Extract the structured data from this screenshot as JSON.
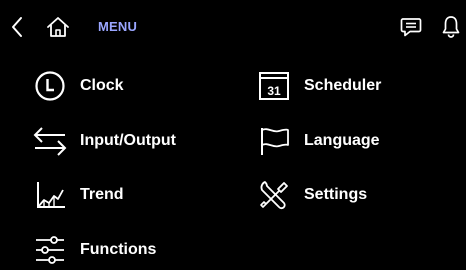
{
  "header": {
    "title": "MENU",
    "back_icon": "chevron-left-icon",
    "home_icon": "home-icon",
    "messages_icon": "message-icon",
    "notifications_icon": "bell-icon"
  },
  "colors": {
    "background": "#000000",
    "text": "#ffffff",
    "title_accent": "#9aa6ff"
  },
  "menu": {
    "left": [
      {
        "label": "Clock",
        "icon": "clock-icon"
      },
      {
        "label": "Input/Output",
        "icon": "input-output-icon"
      },
      {
        "label": "Trend",
        "icon": "trend-icon"
      },
      {
        "label": "Functions",
        "icon": "sliders-icon"
      }
    ],
    "right": [
      {
        "label": "Scheduler",
        "icon": "calendar-icon",
        "icon_text": "31"
      },
      {
        "label": "Language",
        "icon": "flag-icon"
      },
      {
        "label": "Settings",
        "icon": "tools-icon"
      }
    ]
  }
}
